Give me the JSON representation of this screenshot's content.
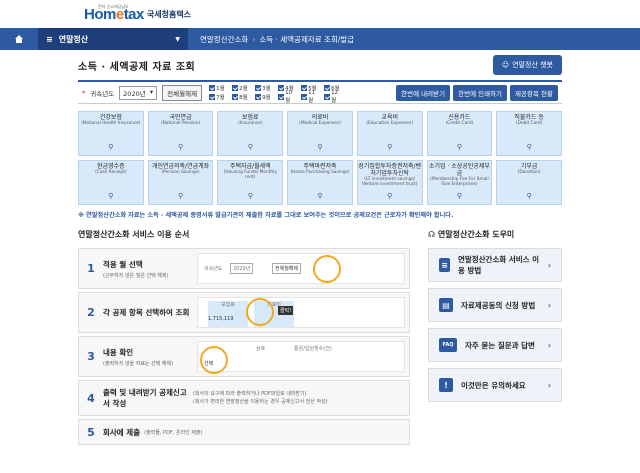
{
  "header": {
    "logo_sub": "전자 신고세금납부",
    "logo_main": "Hom",
    "logo_mid": "e",
    "logo_end": "tax",
    "logo_kr": "국세청홈택스"
  },
  "nav": {
    "menu": "연말정산",
    "crumbs": [
      "연말정산간소화",
      "소득 · 세액공제자료 조회/발급"
    ]
  },
  "title": "소득 · 세액공제 자료 조회",
  "intro_button": "연말정산 챗봇",
  "filter": {
    "year_label": "귀속년도",
    "year_value": "2020년",
    "all_button": "전체월해제",
    "months": [
      "1월",
      "2월",
      "3월",
      "4월",
      "5월",
      "6월",
      "7월",
      "8월",
      "9월",
      "10월",
      "11월",
      "12월"
    ],
    "btn_download": "한번에 내려받기",
    "btn_print": "한번에 인쇄하기",
    "btn_status": "제공항목 현황"
  },
  "categories": [
    {
      "k": "건강보험",
      "e": "(National Health Insurance)"
    },
    {
      "k": "국민연금",
      "e": "(National Pension)"
    },
    {
      "k": "보험료",
      "e": "(Insurance)"
    },
    {
      "k": "의료비",
      "e": "(Medical Expenses)"
    },
    {
      "k": "교육비",
      "e": "(Education Expenses)"
    },
    {
      "k": "신용카드",
      "e": "(Credit Card)"
    },
    {
      "k": "직불카드 등",
      "e": "(Debit Card)"
    },
    {
      "k": "현금영수증",
      "e": "(Cash Receipt)"
    },
    {
      "k": "개인연금저축/연금계좌",
      "e": "(Pension Savings)"
    },
    {
      "k": "주택자금/월세액",
      "e": "(Housing Funds/ Monthly rent)"
    },
    {
      "k": "주택마련저축",
      "e": "(Home Purchasing Savings)"
    },
    {
      "k": "장기집합투자증권저축/벤처기업투자신탁",
      "e": "(LT investment savings/ Venture investment trust)"
    },
    {
      "k": "소기업 · 소상공인공제부금",
      "e": "(Membership Fee For Small Size Enterprises)"
    },
    {
      "k": "기부금",
      "e": "(Donation)"
    }
  ],
  "notice": "※ 연말정산간소화 자료는 소득 · 세액공제 증명서류 발급기관이 제출한 자료를 그대로 보여주는 것이므로 공제요건은 근로자가 확인해야 합니다.",
  "steps_title": "연말정산간소화 서비스 이용 순서",
  "steps": [
    {
      "n": "1",
      "m": "적용 월 선택",
      "s": "(근무하지 않은 월은 선택 해제)",
      "demo1": "귀속년도",
      "demo2": "2020년",
      "demo3": "전체월해제"
    },
    {
      "n": "2",
      "m": "각 공제 항목 선택하여 조회",
      "s": "",
      "demo1": "보험료",
      "demo2": "의료비",
      "demo3": "클릭!",
      "demo4": "1,715,119"
    },
    {
      "n": "3",
      "m": "내용 확인",
      "s": "(출력하지 않을 자료는 선택 해제)",
      "demo1": "상호",
      "demo2": "통원/입원횟수(건)",
      "demo3": "선택"
    },
    {
      "n": "4",
      "m": "출력 및 내려받기 공제신고서 작성",
      "s1": "(회사의 요구에 따라 출력하거나 PDF파일로 내려받기)",
      "s2": "(회사가 편리한 연말정산을 이용하는 경우 공제신고서 전산 작성)"
    },
    {
      "n": "5",
      "m": "회사에 제출",
      "s": "(출력물, PDF, 온라인 제출)"
    }
  ],
  "help_title": "연말정산간소화 도우미",
  "help": [
    {
      "t": "연말정산간소화 서비스 이용 방법",
      "icon": "document-icon",
      "ic": "≡"
    },
    {
      "t": "자료제공동의 신청 방법",
      "icon": "form-icon",
      "ic": "▤"
    },
    {
      "t": "자주 묻는 질문과 답변",
      "icon": "faq-icon",
      "ic": "FAQ"
    },
    {
      "t": "이것만은 유의하세요",
      "icon": "alert-icon",
      "ic": "!"
    }
  ]
}
